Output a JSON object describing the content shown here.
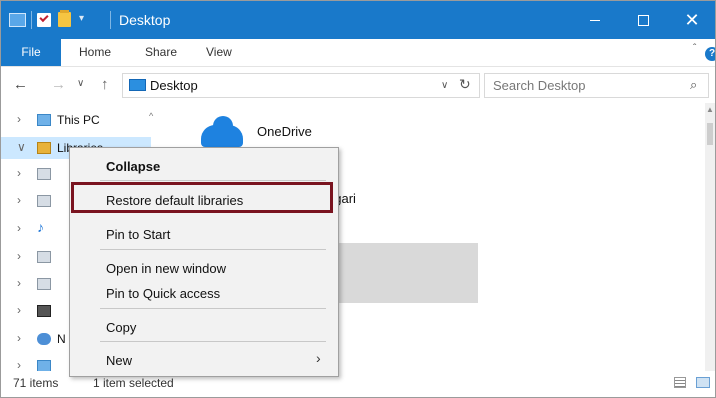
{
  "window": {
    "title": "Desktop",
    "close_glyph": "✕",
    "colors": {
      "titlebar": "#1979ca",
      "highlight": "#7a1420"
    }
  },
  "ribbon": {
    "tabs": [
      "File",
      "Home",
      "Share",
      "View"
    ],
    "help_glyph": "?"
  },
  "address": {
    "back": "←",
    "forward": "→",
    "recent": "∨",
    "up": "↑",
    "path": "Desktop",
    "dropdown": "∨",
    "refresh": "↻"
  },
  "search": {
    "placeholder": "Search Desktop",
    "icon": "⌕"
  },
  "nav_pane": {
    "items": [
      {
        "label": "This PC",
        "chevron": "›",
        "icon": "pc-icon"
      },
      {
        "label": "Libraries",
        "chevron": "∨",
        "icon": "libraries-icon"
      },
      {
        "label": "",
        "chevron": "›",
        "icon": "documents-icon"
      },
      {
        "label": "",
        "chevron": "›",
        "icon": "documents-icon"
      },
      {
        "label": "",
        "chevron": "›",
        "icon": "music-icon"
      },
      {
        "label": "",
        "chevron": "›",
        "icon": "pictures-icon"
      },
      {
        "label": "",
        "chevron": "›",
        "icon": "pictures-icon"
      },
      {
        "label": "",
        "chevron": "›",
        "icon": "videos-icon"
      },
      {
        "label": "N",
        "chevron": "›",
        "icon": "network-icon"
      },
      {
        "label": "",
        "chevron": "›",
        "icon": "homegroup-icon"
      }
    ],
    "scroll_up": "^"
  },
  "content": {
    "items": [
      {
        "name": "OneDrive",
        "icon": "cloud-icon"
      },
      {
        "name": "agari",
        "icon": ""
      }
    ]
  },
  "context_menu": {
    "items": [
      {
        "label": "Collapse",
        "bold": true
      },
      {
        "label": "Restore default libraries",
        "highlighted": true
      },
      {
        "label": "Pin to Start"
      },
      {
        "label": "Open in new window"
      },
      {
        "label": "Pin to Quick access"
      },
      {
        "label": "Copy"
      },
      {
        "label": "New",
        "submenu_glyph": "›"
      }
    ]
  },
  "status": {
    "item_count": "71 items",
    "selection": "1 item selected"
  }
}
